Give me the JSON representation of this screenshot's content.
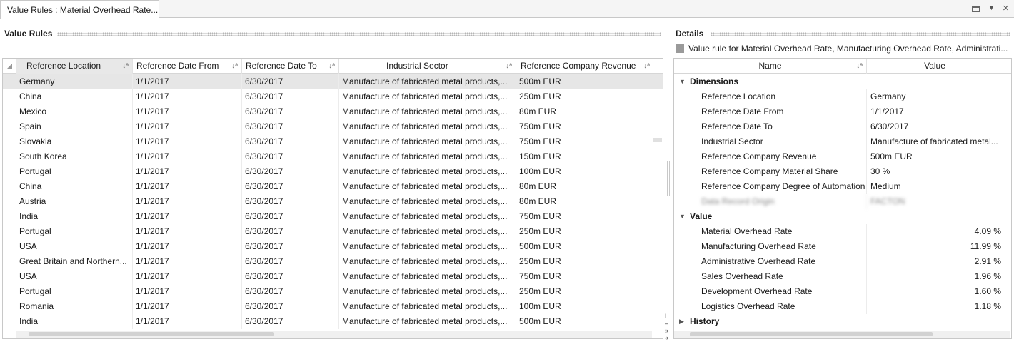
{
  "tab": {
    "title": "Value Rules : Material Overhead Rate..."
  },
  "left_panel": {
    "title": "Value Rules",
    "columns": [
      "Reference Location",
      "Reference Date From",
      "Reference Date To",
      "Industrial Sector",
      "Reference Company Revenue"
    ],
    "rows": [
      [
        "Germany",
        "1/1/2017",
        "6/30/2017",
        "Manufacture of fabricated metal products,...",
        "500m EUR"
      ],
      [
        "China",
        "1/1/2017",
        "6/30/2017",
        "Manufacture of fabricated metal products,...",
        "250m EUR"
      ],
      [
        "Mexico",
        "1/1/2017",
        "6/30/2017",
        "Manufacture of fabricated metal products,...",
        "80m EUR"
      ],
      [
        "Spain",
        "1/1/2017",
        "6/30/2017",
        "Manufacture of fabricated metal products,...",
        "750m EUR"
      ],
      [
        "Slovakia",
        "1/1/2017",
        "6/30/2017",
        "Manufacture of fabricated metal products,...",
        "750m EUR"
      ],
      [
        "South Korea",
        "1/1/2017",
        "6/30/2017",
        "Manufacture of fabricated metal products,...",
        "150m EUR"
      ],
      [
        "Portugal",
        "1/1/2017",
        "6/30/2017",
        "Manufacture of fabricated metal products,...",
        "100m EUR"
      ],
      [
        "China",
        "1/1/2017",
        "6/30/2017",
        "Manufacture of fabricated metal products,...",
        "80m EUR"
      ],
      [
        "Austria",
        "1/1/2017",
        "6/30/2017",
        "Manufacture of fabricated metal products,...",
        "80m EUR"
      ],
      [
        "India",
        "1/1/2017",
        "6/30/2017",
        "Manufacture of fabricated metal products,...",
        "750m EUR"
      ],
      [
        "Portugal",
        "1/1/2017",
        "6/30/2017",
        "Manufacture of fabricated metal products,...",
        "250m EUR"
      ],
      [
        "USA",
        "1/1/2017",
        "6/30/2017",
        "Manufacture of fabricated metal products,...",
        "500m EUR"
      ],
      [
        "Great Britain and Northern...",
        "1/1/2017",
        "6/30/2017",
        "Manufacture of fabricated metal products,...",
        "250m EUR"
      ],
      [
        "USA",
        "1/1/2017",
        "6/30/2017",
        "Manufacture of fabricated metal products,...",
        "750m EUR"
      ],
      [
        "Portugal",
        "1/1/2017",
        "6/30/2017",
        "Manufacture of fabricated metal products,...",
        "250m EUR"
      ],
      [
        "Romania",
        "1/1/2017",
        "6/30/2017",
        "Manufacture of fabricated metal products,...",
        "100m EUR"
      ],
      [
        "India",
        "1/1/2017",
        "6/30/2017",
        "Manufacture of fabricated metal products,...",
        "500m EUR"
      ]
    ]
  },
  "details": {
    "title": "Details",
    "description": "Value rule for Material Overhead Rate, Manufacturing Overhead Rate, Administrati...",
    "columns": [
      "Name",
      "Value"
    ],
    "dimensions_label": "Dimensions",
    "dimensions": [
      [
        "Reference Location",
        "Germany"
      ],
      [
        "Reference Date From",
        "1/1/2017"
      ],
      [
        "Reference Date To",
        "6/30/2017"
      ],
      [
        "Industrial Sector",
        "Manufacture of fabricated metal..."
      ],
      [
        "Reference Company Revenue",
        "500m EUR"
      ],
      [
        "Reference Company Material Share",
        "30 %"
      ],
      [
        "Reference Company Degree of Automation",
        "Medium"
      ],
      [
        "Data Record Origin",
        "FACTON"
      ]
    ],
    "value_label": "Value",
    "values": [
      [
        "Material Overhead Rate",
        "4.09 %"
      ],
      [
        "Manufacturing Overhead Rate",
        "11.99 %"
      ],
      [
        "Administrative Overhead Rate",
        "2.91 %"
      ],
      [
        "Sales Overhead Rate",
        "1.96 %"
      ],
      [
        "Development Overhead Rate",
        "1.60 %"
      ],
      [
        "Logistics Overhead Rate",
        "1.18 %"
      ]
    ],
    "history_label": "History"
  }
}
